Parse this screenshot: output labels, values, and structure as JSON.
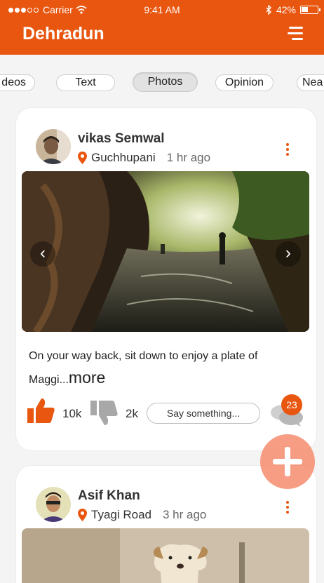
{
  "status": {
    "carrier": "Carrier",
    "time": "9:41 AM",
    "battery": "42%",
    "battery_level": 0.42
  },
  "header": {
    "title": "Dehradun"
  },
  "tabs": [
    {
      "label": "Videos",
      "shown": "deos"
    },
    {
      "label": "Text"
    },
    {
      "label": "Photos",
      "active": true
    },
    {
      "label": "Opinion"
    },
    {
      "label": "Nearby",
      "shown": "Nea"
    }
  ],
  "posts": [
    {
      "author": "vikas Semwal",
      "location": "Guchhupani",
      "time_ago": "1 hr ago",
      "caption": "On your way back, sit down to enjoy a plate of Maggi...",
      "more": "more",
      "likes": "10k",
      "dislikes": "2k",
      "comment_placeholder": "Say something...",
      "comment_count": "23"
    },
    {
      "author": "Asif Khan",
      "location": "Tyagi Road",
      "time_ago": "3 hr ago"
    }
  ],
  "icons": {
    "menu": "hamburger-icon",
    "location": "map-pin-icon",
    "more": "vertical-dots-icon",
    "like": "thumbs-up-icon",
    "dislike": "thumbs-down-icon",
    "comment": "chat-bubbles-icon",
    "prev": "chevron-left-icon",
    "next": "chevron-right-icon",
    "add": "plus-icon"
  },
  "colors": {
    "accent": "#e8560f",
    "fab": "#f68c6e"
  }
}
